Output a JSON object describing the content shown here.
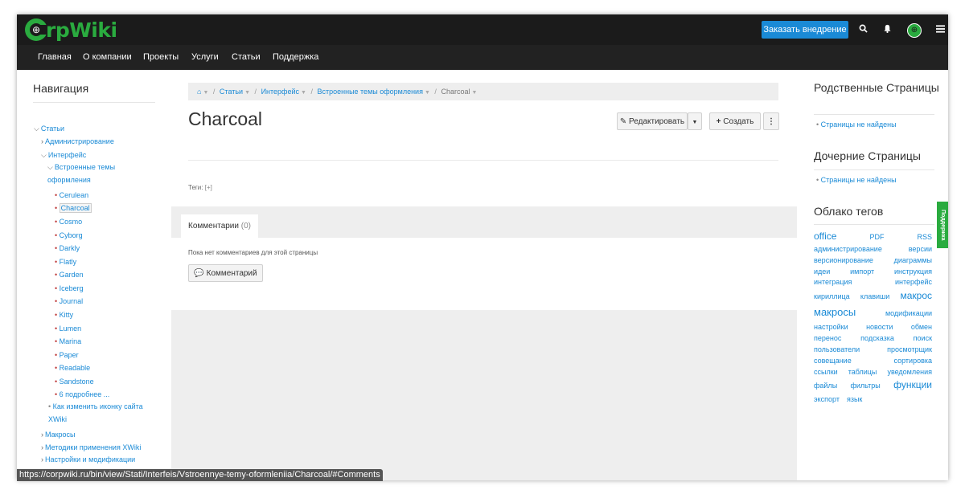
{
  "header": {
    "logo_mark": "C",
    "logo_text": "rpWiki",
    "order_button": "Заказать внедрение",
    "icons": [
      "search-icon",
      "bell-icon",
      "globe-icon",
      "menu-icon"
    ]
  },
  "menu": [
    "Главная",
    "О компании",
    "Проекты",
    "Услуги",
    "Статьи",
    "Поддержка"
  ],
  "nav": {
    "title": "Навигация",
    "items": [
      {
        "label": "Статьи"
      },
      {
        "label": "Администрирование"
      },
      {
        "label": "Интерфейс"
      },
      {
        "label": "Встроенные темы оформления"
      },
      {
        "label": "Cerulean"
      },
      {
        "label": "Charcoal"
      },
      {
        "label": "Cosmo"
      },
      {
        "label": "Cyborg"
      },
      {
        "label": "Darkly"
      },
      {
        "label": "Flatly"
      },
      {
        "label": "Garden"
      },
      {
        "label": "Iceberg"
      },
      {
        "label": "Journal"
      },
      {
        "label": "Kitty"
      },
      {
        "label": "Lumen"
      },
      {
        "label": "Marina"
      },
      {
        "label": "Paper"
      },
      {
        "label": "Readable"
      },
      {
        "label": "Sandstone"
      },
      {
        "label": "6 подробнее ..."
      },
      {
        "label": "Как изменить иконку сайта XWiki"
      },
      {
        "label": "Макросы"
      },
      {
        "label": "Методики применения XWiki"
      },
      {
        "label": "Настройки и модификации XWiki"
      }
    ]
  },
  "breadcrumb": [
    "Статьи",
    "Интерфейс",
    "Встроенные темы оформления",
    "Charcoal"
  ],
  "page": {
    "title": "Charcoal",
    "edit_label": "Редактировать",
    "create_label": "Создать",
    "tags_label": "Теги:",
    "tags_add": "[+]"
  },
  "comments": {
    "tab_label": "Комментарии",
    "tab_count": "(0)",
    "empty_text": "Пока нет комментариев для этой страницы",
    "button_label": "Комментарий"
  },
  "related": {
    "title": "Родственные Страницы",
    "empty": "Страницы не найдены"
  },
  "children": {
    "title": "Дочерние Страницы",
    "empty": "Страницы не найдены"
  },
  "tagcloud": {
    "title": "Облако тегов",
    "tags": [
      "office",
      "PDF",
      "RSS",
      "администрирование",
      "версии",
      "версионирование",
      "диаграммы",
      "идеи",
      "импорт",
      "инструкция",
      "интеграция",
      "интерфейс",
      "кириллица",
      "клавиши",
      "макрос",
      "макросы",
      "модификации",
      "настройки",
      "новости",
      "обмен",
      "перенос",
      "подсказка",
      "поиск",
      "пользователи",
      "просмотрщик",
      "совещание",
      "сортировка",
      "ссылки",
      "таблицы",
      "уведомления",
      "файлы",
      "фильтры",
      "функции",
      "экспорт",
      "язык"
    ]
  },
  "support_tab": "Поддержка",
  "status_url": "https://corpwiki.ru/bin/view/Stati/Interfeis/Vstroennye-temy-oformleniia/Charcoal/#Comments",
  "colors": {
    "accent": "#1a8ad6",
    "brand": "#2aab3f",
    "topbar": "#1b1b1b"
  }
}
